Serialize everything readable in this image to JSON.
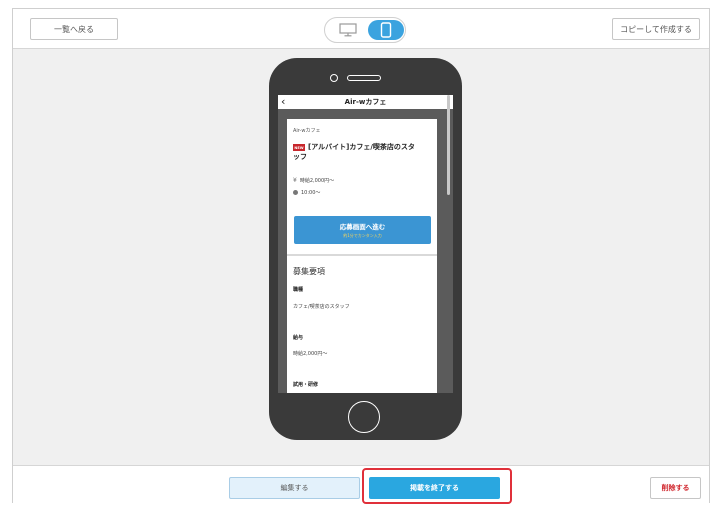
{
  "toolbar": {
    "back_label": "一覧へ戻る",
    "copy_label": "コピーして作成する",
    "device_toggle": {
      "options": [
        "desktop",
        "mobile"
      ],
      "selected": "mobile"
    }
  },
  "preview": {
    "app_title": "Air-wカフェ",
    "company": "Air-wカフェ",
    "new_badge": "NEW",
    "job_title_line1": "[アルバイト]カフェ/喫茶店のスタ",
    "job_title_line2": "ッフ",
    "salary": "時給2,000円〜",
    "time": "10:00〜",
    "apply_main": "応募画面へ進む",
    "apply_sub": "約1分でカンタン入力",
    "section_title": "募集要項",
    "fields": [
      {
        "label": "職種",
        "value": "カフェ/喫茶店のスタッフ"
      },
      {
        "label": "給与",
        "value": "時給2,000円〜"
      },
      {
        "label": "試用・研修",
        "value": ""
      }
    ]
  },
  "footer": {
    "edit_label": "編集する",
    "end_label": "掲載を終了する",
    "delete_label": "削除する"
  },
  "colors": {
    "accent": "#2aa7e0",
    "highlight": "#e0303a",
    "delete_text": "#d0262d",
    "new_badge": "#c8272d"
  }
}
